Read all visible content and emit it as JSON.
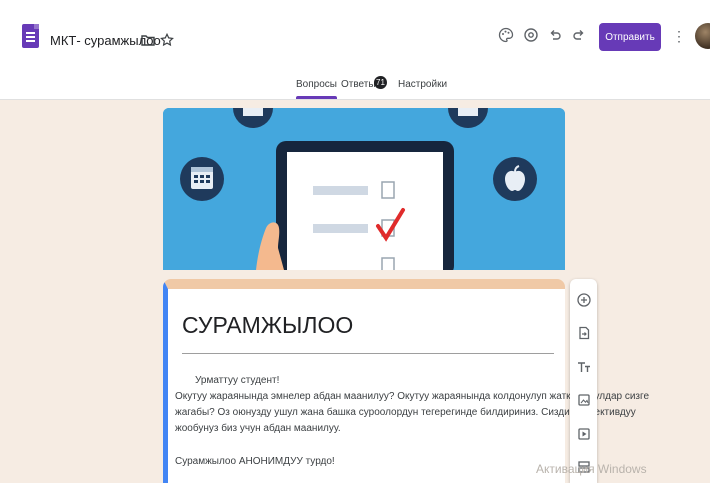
{
  "header": {
    "doc_title": "МКТ- сурамжылоо",
    "send_label": "Отправить",
    "more_label": "⋮",
    "icons": [
      "folder-icon",
      "star-icon",
      "palette-icon",
      "preview-icon",
      "undo-icon",
      "redo-icon"
    ]
  },
  "tabs": [
    {
      "label": "Вопросы",
      "active": true
    },
    {
      "label": "Ответы",
      "active": false,
      "badge": "71"
    },
    {
      "label": "Настройки",
      "active": false
    }
  ],
  "form": {
    "title": "СУРАМЖЫЛОО",
    "description": [
      "Урматтуу студент!",
      "Окутуу жараянында эмнелер абдан маанилуу? Окутуу жараянында колдонулуп жаткан усулдар сизге",
      "жагабы? Оз оюнузду ушул жана башка суроолордун тегерегинде билдириниз. Сиздин обьективдуу",
      "жообунуз биз учун абдан маанилуу.",
      "Сурамжылоо АНОНИМДУУ турдо!"
    ]
  },
  "side_toolbar": [
    "add-question-icon",
    "import-questions-icon",
    "add-title-icon",
    "add-image-icon",
    "add-video-icon",
    "add-section-icon"
  ],
  "watermark": "Активация Windows",
  "colors": {
    "accent": "#673ab7",
    "banner": "#44a7dd",
    "page_background": "#f6ece3",
    "card_top": "#f0c9a6",
    "card_left": "#4285f4"
  }
}
